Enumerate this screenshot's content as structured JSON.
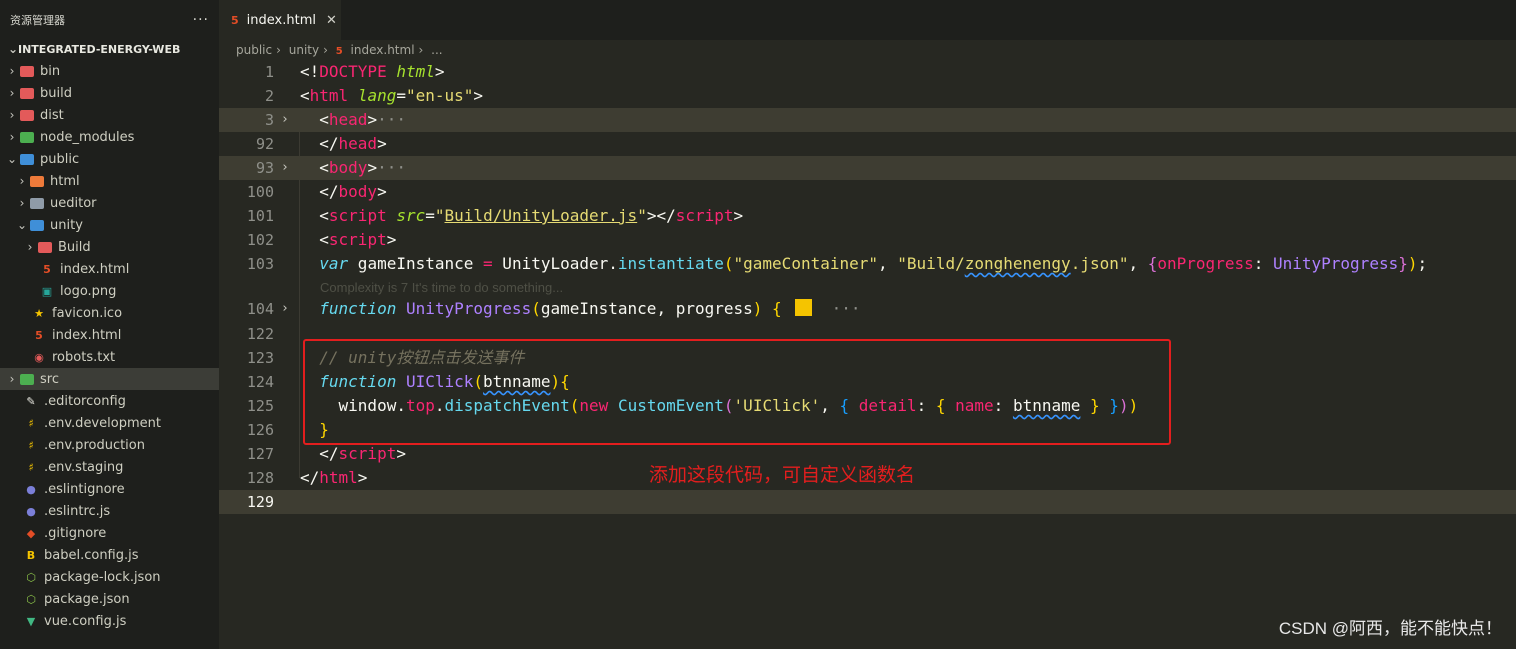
{
  "explorer": {
    "title": "资源管理器",
    "more": "···",
    "project": "INTEGRATED-ENERGY-WEB",
    "items": [
      {
        "label": "bin"
      },
      {
        "label": "build"
      },
      {
        "label": "dist"
      },
      {
        "label": "node_modules"
      },
      {
        "label": "public"
      },
      {
        "label": "html"
      },
      {
        "label": "ueditor"
      },
      {
        "label": "unity"
      },
      {
        "label": "Build"
      },
      {
        "label": "index.html"
      },
      {
        "label": "logo.png"
      },
      {
        "label": "favicon.ico"
      },
      {
        "label": "index.html"
      },
      {
        "label": "robots.txt"
      },
      {
        "label": "src"
      },
      {
        "label": ".editorconfig"
      },
      {
        "label": ".env.development"
      },
      {
        "label": ".env.production"
      },
      {
        "label": ".env.staging"
      },
      {
        "label": ".eslintignore"
      },
      {
        "label": ".eslintrc.js"
      },
      {
        "label": ".gitignore"
      },
      {
        "label": "babel.config.js"
      },
      {
        "label": "package-lock.json"
      },
      {
        "label": "package.json"
      },
      {
        "label": "vue.config.js"
      }
    ]
  },
  "tab": {
    "label": "index.html",
    "close": "✕"
  },
  "breadcrumb": {
    "p1": "public",
    "p2": "unity",
    "p3": "index.html",
    "p4": "..."
  },
  "code": {
    "ln": [
      "1",
      "2",
      "3",
      "92",
      "93",
      "100",
      "101",
      "102",
      "103",
      "104",
      "122",
      "123",
      "124",
      "125",
      "126",
      "127",
      "128",
      "129"
    ],
    "hint": "Complexity is 7 It's time to do something...",
    "comment": "// unity按钮点击发送事件"
  },
  "annotation": "添加这段代码，可自定义函数名",
  "watermark": "CSDN @阿西，能不能快点！"
}
